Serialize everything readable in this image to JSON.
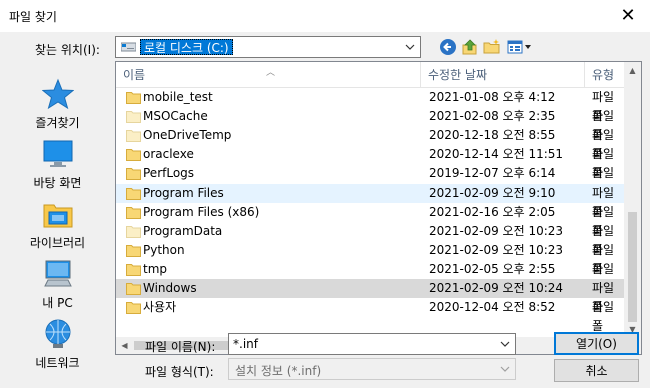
{
  "window": {
    "title": "파일 찾기",
    "close_glyph": "✕"
  },
  "look_in": {
    "label": "찾는 위치(I):",
    "value": "로컬 디스크 (C:)"
  },
  "toolbar": {
    "back_icon": "back-arrow-icon",
    "up_icon": "up-folder-icon",
    "new_folder_icon": "new-folder-icon",
    "view_icon": "view-menu-icon"
  },
  "places": [
    {
      "label": "즐겨찾기",
      "icon": "star-icon"
    },
    {
      "label": "바탕 화면",
      "icon": "desktop-icon"
    },
    {
      "label": "라이브러리",
      "icon": "library-icon"
    },
    {
      "label": "내 PC",
      "icon": "computer-icon"
    },
    {
      "label": "네트워크",
      "icon": "network-icon"
    }
  ],
  "columns": {
    "name": "이름",
    "date": "수정한 날짜",
    "type": "유형"
  },
  "files": [
    {
      "name": "mobile_test",
      "date": "2021-01-08 오후 4:12",
      "type": "파일 폴",
      "state": "",
      "faded": false
    },
    {
      "name": "MSOCache",
      "date": "2021-02-08 오후 2:35",
      "type": "파일 폴",
      "state": "",
      "faded": true
    },
    {
      "name": "OneDriveTemp",
      "date": "2020-12-18 오전 8:55",
      "type": "파일 폴",
      "state": "",
      "faded": true
    },
    {
      "name": "oraclexe",
      "date": "2020-12-14 오전 11:51",
      "type": "파일 폴",
      "state": "",
      "faded": false
    },
    {
      "name": "PerfLogs",
      "date": "2019-12-07 오후 6:14",
      "type": "파일 폴",
      "state": "",
      "faded": false
    },
    {
      "name": "Program Files",
      "date": "2021-02-09 오전 9:10",
      "type": "파일 폴",
      "state": "hover",
      "faded": false
    },
    {
      "name": "Program Files (x86)",
      "date": "2021-02-16 오후 2:05",
      "type": "파일 폴",
      "state": "",
      "faded": false
    },
    {
      "name": "ProgramData",
      "date": "2021-02-09 오전 10:23",
      "type": "파일 폴",
      "state": "",
      "faded": true
    },
    {
      "name": "Python",
      "date": "2021-02-09 오전 10:23",
      "type": "파일 폴",
      "state": "",
      "faded": false
    },
    {
      "name": "tmp",
      "date": "2021-02-05 오후 2:55",
      "type": "파일 폴",
      "state": "",
      "faded": false
    },
    {
      "name": "Windows",
      "date": "2021-02-09 오전 10:24",
      "type": "파일 폴",
      "state": "selected",
      "faded": false
    },
    {
      "name": "사용자",
      "date": "2020-12-04 오전 8:52",
      "type": "파일 폴",
      "state": "",
      "faded": false
    }
  ],
  "file_name": {
    "label": "파일 이름(N):",
    "value": "*.inf"
  },
  "file_type": {
    "label": "파일 형식(T):",
    "value": "설치 정보 (*.inf)"
  },
  "buttons": {
    "open": "열기(O)",
    "cancel": "취소"
  },
  "colors": {
    "accent": "#0078d7",
    "hover_row": "#e5f3ff",
    "selected_row": "#d9d9d9",
    "folder": "#f8d775"
  }
}
